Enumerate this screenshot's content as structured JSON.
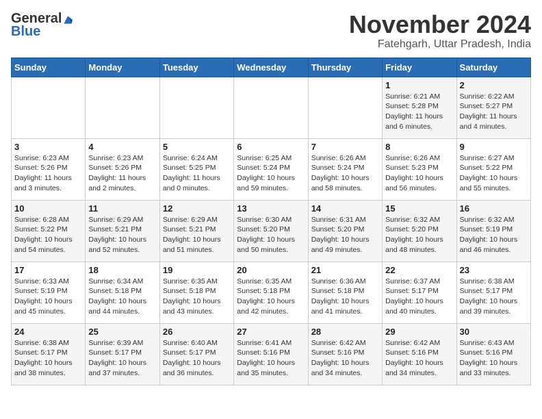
{
  "logo": {
    "general": "General",
    "blue": "Blue"
  },
  "header": {
    "month": "November 2024",
    "location": "Fatehgarh, Uttar Pradesh, India"
  },
  "weekdays": [
    "Sunday",
    "Monday",
    "Tuesday",
    "Wednesday",
    "Thursday",
    "Friday",
    "Saturday"
  ],
  "weeks": [
    [
      {
        "day": "",
        "info": ""
      },
      {
        "day": "",
        "info": ""
      },
      {
        "day": "",
        "info": ""
      },
      {
        "day": "",
        "info": ""
      },
      {
        "day": "",
        "info": ""
      },
      {
        "day": "1",
        "info": "Sunrise: 6:21 AM\nSunset: 5:28 PM\nDaylight: 11 hours and 6 minutes."
      },
      {
        "day": "2",
        "info": "Sunrise: 6:22 AM\nSunset: 5:27 PM\nDaylight: 11 hours and 4 minutes."
      }
    ],
    [
      {
        "day": "3",
        "info": "Sunrise: 6:23 AM\nSunset: 5:26 PM\nDaylight: 11 hours and 3 minutes."
      },
      {
        "day": "4",
        "info": "Sunrise: 6:23 AM\nSunset: 5:26 PM\nDaylight: 11 hours and 2 minutes."
      },
      {
        "day": "5",
        "info": "Sunrise: 6:24 AM\nSunset: 5:25 PM\nDaylight: 11 hours and 0 minutes."
      },
      {
        "day": "6",
        "info": "Sunrise: 6:25 AM\nSunset: 5:24 PM\nDaylight: 10 hours and 59 minutes."
      },
      {
        "day": "7",
        "info": "Sunrise: 6:26 AM\nSunset: 5:24 PM\nDaylight: 10 hours and 58 minutes."
      },
      {
        "day": "8",
        "info": "Sunrise: 6:26 AM\nSunset: 5:23 PM\nDaylight: 10 hours and 56 minutes."
      },
      {
        "day": "9",
        "info": "Sunrise: 6:27 AM\nSunset: 5:22 PM\nDaylight: 10 hours and 55 minutes."
      }
    ],
    [
      {
        "day": "10",
        "info": "Sunrise: 6:28 AM\nSunset: 5:22 PM\nDaylight: 10 hours and 54 minutes."
      },
      {
        "day": "11",
        "info": "Sunrise: 6:29 AM\nSunset: 5:21 PM\nDaylight: 10 hours and 52 minutes."
      },
      {
        "day": "12",
        "info": "Sunrise: 6:29 AM\nSunset: 5:21 PM\nDaylight: 10 hours and 51 minutes."
      },
      {
        "day": "13",
        "info": "Sunrise: 6:30 AM\nSunset: 5:20 PM\nDaylight: 10 hours and 50 minutes."
      },
      {
        "day": "14",
        "info": "Sunrise: 6:31 AM\nSunset: 5:20 PM\nDaylight: 10 hours and 49 minutes."
      },
      {
        "day": "15",
        "info": "Sunrise: 6:32 AM\nSunset: 5:20 PM\nDaylight: 10 hours and 48 minutes."
      },
      {
        "day": "16",
        "info": "Sunrise: 6:32 AM\nSunset: 5:19 PM\nDaylight: 10 hours and 46 minutes."
      }
    ],
    [
      {
        "day": "17",
        "info": "Sunrise: 6:33 AM\nSunset: 5:19 PM\nDaylight: 10 hours and 45 minutes."
      },
      {
        "day": "18",
        "info": "Sunrise: 6:34 AM\nSunset: 5:18 PM\nDaylight: 10 hours and 44 minutes."
      },
      {
        "day": "19",
        "info": "Sunrise: 6:35 AM\nSunset: 5:18 PM\nDaylight: 10 hours and 43 minutes."
      },
      {
        "day": "20",
        "info": "Sunrise: 6:35 AM\nSunset: 5:18 PM\nDaylight: 10 hours and 42 minutes."
      },
      {
        "day": "21",
        "info": "Sunrise: 6:36 AM\nSunset: 5:18 PM\nDaylight: 10 hours and 41 minutes."
      },
      {
        "day": "22",
        "info": "Sunrise: 6:37 AM\nSunset: 5:17 PM\nDaylight: 10 hours and 40 minutes."
      },
      {
        "day": "23",
        "info": "Sunrise: 6:38 AM\nSunset: 5:17 PM\nDaylight: 10 hours and 39 minutes."
      }
    ],
    [
      {
        "day": "24",
        "info": "Sunrise: 6:38 AM\nSunset: 5:17 PM\nDaylight: 10 hours and 38 minutes."
      },
      {
        "day": "25",
        "info": "Sunrise: 6:39 AM\nSunset: 5:17 PM\nDaylight: 10 hours and 37 minutes."
      },
      {
        "day": "26",
        "info": "Sunrise: 6:40 AM\nSunset: 5:17 PM\nDaylight: 10 hours and 36 minutes."
      },
      {
        "day": "27",
        "info": "Sunrise: 6:41 AM\nSunset: 5:16 PM\nDaylight: 10 hours and 35 minutes."
      },
      {
        "day": "28",
        "info": "Sunrise: 6:42 AM\nSunset: 5:16 PM\nDaylight: 10 hours and 34 minutes."
      },
      {
        "day": "29",
        "info": "Sunrise: 6:42 AM\nSunset: 5:16 PM\nDaylight: 10 hours and 34 minutes."
      },
      {
        "day": "30",
        "info": "Sunrise: 6:43 AM\nSunset: 5:16 PM\nDaylight: 10 hours and 33 minutes."
      }
    ]
  ]
}
